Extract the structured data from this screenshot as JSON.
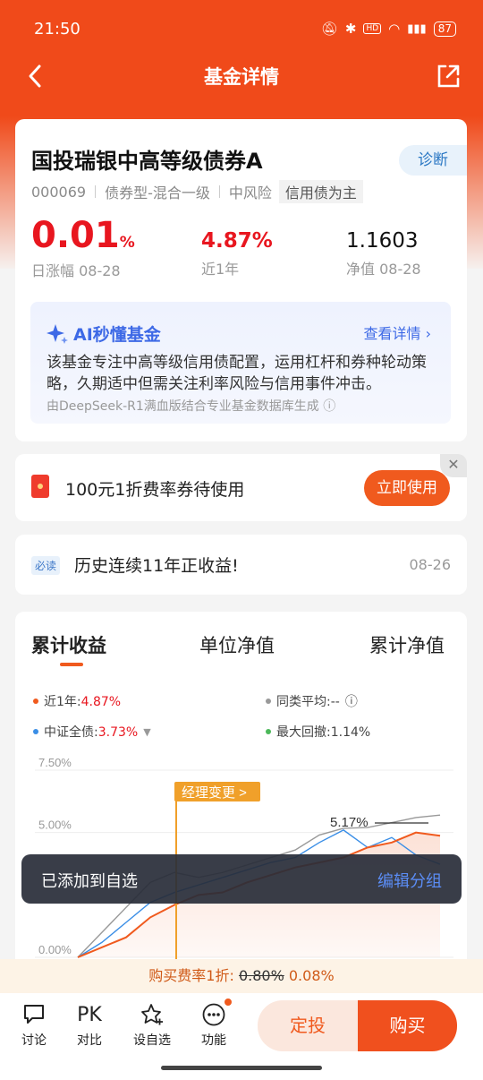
{
  "status_bar": {
    "time": "21:50",
    "battery": "87",
    "network": "4G"
  },
  "nav": {
    "title": "基金详情"
  },
  "fund": {
    "name": "国投瑞银中高等级债券A",
    "diagnose_label": "诊断",
    "code": "000069",
    "category": "债券型-混合一级",
    "risk": "中风险",
    "feature_tag": "信用债为主",
    "daily_change": "0.01",
    "daily_change_unit": "%",
    "daily_change_label": "日涨幅 08-28",
    "year_return": "4.87%",
    "year_return_label": "近1年",
    "nav_value": "1.1603",
    "nav_label": "净值 08-28"
  },
  "ai": {
    "title": "AI秒懂基金",
    "link": "查看详情",
    "text": "该基金专注中高等级信用债配置，运用杠杆和券种轮动策略，久期适中但需关注利率风险与信用事件冲击。",
    "footer": "由DeepSeek-R1满血版结合专业基金数据库生成"
  },
  "coupon": {
    "text": "100元1折费率券待使用",
    "button": "立即使用"
  },
  "notice": {
    "tag": "必读",
    "text": "历史连续11年正收益!",
    "date": "08-26"
  },
  "chart": {
    "tabs": [
      "累计收益",
      "单位净值",
      "累计净值"
    ],
    "legend_year_label": "近1年:",
    "legend_year_value": "4.87%",
    "legend_peer_label": "同类平均:--",
    "legend_index_label": "中证全债:",
    "legend_index_value": "3.73%",
    "legend_drawdown_label": "最大回撤:",
    "legend_drawdown_value": "1.14%",
    "manager_change": "经理变更 >",
    "peak_label": "5.17%",
    "colors": {
      "fund": "#f05a1e",
      "index": "#3a8ee6",
      "peer": "#999999",
      "drawdown": "#4cb85a"
    }
  },
  "chart_data": {
    "type": "line",
    "ylabels": [
      "7.50%",
      "5.00%",
      "0.00%"
    ],
    "ylim": [
      0,
      7.5
    ],
    "series": [
      {
        "name": "近1年",
        "values": [
          0,
          0.4,
          0.8,
          1.6,
          2.1,
          2.5,
          2.6,
          3.0,
          3.3,
          3.6,
          3.8,
          4.0,
          4.4,
          4.6,
          5.0,
          4.87
        ]
      },
      {
        "name": "中证全债",
        "values": [
          0,
          0.6,
          1.4,
          2.2,
          2.6,
          2.9,
          3.2,
          3.5,
          3.8,
          4.0,
          4.6,
          5.1,
          4.4,
          4.8,
          4.1,
          3.73
        ]
      },
      {
        "name": "同类平均",
        "values": [
          0,
          1.0,
          2.0,
          3.0,
          3.4,
          3.2,
          3.4,
          3.7,
          4.0,
          4.3,
          4.9,
          5.17,
          5.2,
          5.4,
          5.6,
          5.7
        ]
      }
    ]
  },
  "toast": {
    "text": "已添加到自选",
    "action": "编辑分组"
  },
  "promo": {
    "label": "购买费率1折:",
    "old_rate": "0.80%",
    "new_rate": "0.08%"
  },
  "bottom": {
    "items": [
      {
        "icon": "comment-icon",
        "label": "讨论"
      },
      {
        "icon": "pk-icon",
        "glyph": "PK",
        "label": "对比"
      },
      {
        "icon": "star-add-icon",
        "label": "设自选"
      },
      {
        "icon": "more-icon",
        "label": "功能"
      }
    ],
    "dingtou": "定投",
    "buy": "购买"
  }
}
